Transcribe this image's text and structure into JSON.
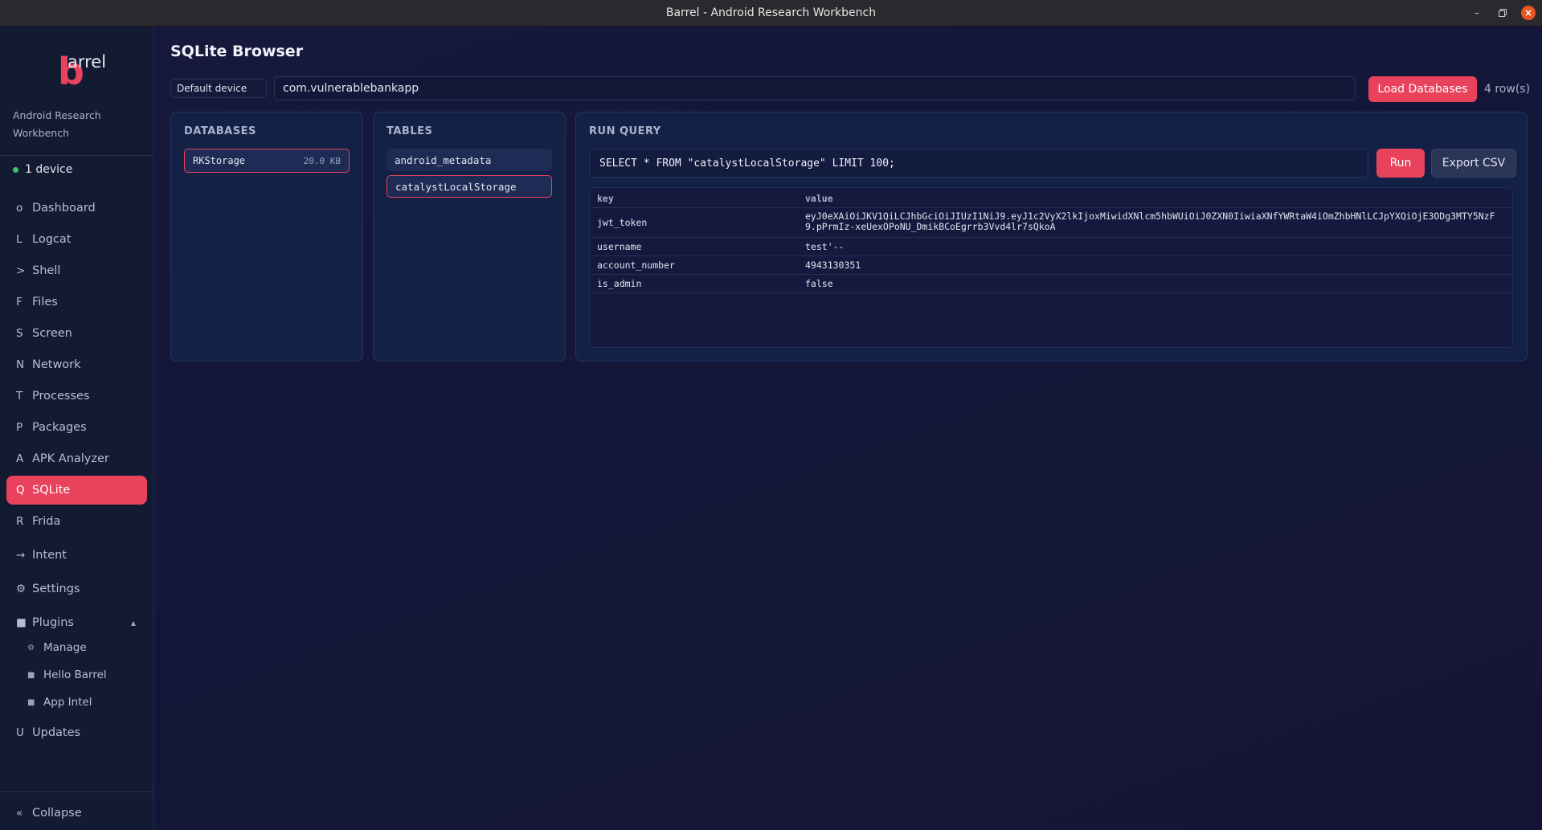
{
  "window": {
    "title": "Barrel - Android Research Workbench"
  },
  "sidebar": {
    "logo_text": "arrel",
    "logo_letter": "b",
    "tagline": "Android Research Workbench",
    "device_status": "1 device",
    "nav": [
      {
        "glyph": "o",
        "label": "Dashboard"
      },
      {
        "glyph": "L",
        "label": "Logcat"
      },
      {
        "glyph": ">",
        "label": "Shell"
      },
      {
        "glyph": "F",
        "label": "Files"
      },
      {
        "glyph": "S",
        "label": "Screen"
      },
      {
        "glyph": "N",
        "label": "Network"
      },
      {
        "glyph": "T",
        "label": "Processes"
      },
      {
        "glyph": "P",
        "label": "Packages"
      },
      {
        "glyph": "A",
        "label": "APK Analyzer"
      },
      {
        "glyph": "Q",
        "label": "SQLite"
      },
      {
        "glyph": "R",
        "label": "Frida"
      },
      {
        "glyph": "→",
        "label": "Intent"
      },
      {
        "glyph": "⚙",
        "label": "Settings"
      },
      {
        "glyph": "■",
        "label": "Plugins"
      }
    ],
    "plugins_caret": "▲",
    "plugin_items": [
      {
        "glyph": "⚙",
        "label": "Manage"
      },
      {
        "glyph": "■",
        "label": "Hello Barrel"
      },
      {
        "glyph": "■",
        "label": "App Intel"
      }
    ],
    "updates": {
      "glyph": "U",
      "label": "Updates"
    },
    "collapse": {
      "glyph": "«",
      "label": "Collapse"
    }
  },
  "main": {
    "title": "SQLite Browser",
    "device_select": "Default device",
    "package_value": "com.vulnerablebankapp",
    "load_button": "Load Databases",
    "row_count": "4 row(s)",
    "databases": {
      "label": "DATABASES",
      "items": [
        {
          "name": "RKStorage",
          "size": "20.0 KB"
        }
      ]
    },
    "tables": {
      "label": "TABLES",
      "items": [
        "android_metadata",
        "catalystLocalStorage"
      ]
    },
    "query": {
      "label": "RUN QUERY",
      "sql": "SELECT * FROM \"catalystLocalStorage\" LIMIT 100;",
      "run_button": "Run",
      "export_button": "Export CSV",
      "columns": [
        "key",
        "value"
      ],
      "rows": [
        {
          "key": "jwt_token",
          "value": "eyJ0eXAiOiJKV1QiLCJhbGciOiJIUzI1NiJ9.eyJ1c2VyX2lkIjoxMiwidXNlcm5hbWUiOiJ0ZXN0IiwiaXNfYWRtaW4iOmZhbHNlLCJpYXQiOjE3ODg3MTY5NzF9.pPrmIz-xeUexOPoNU_DmikBCoEgrrb3Vvd4lr7sQkoA"
        },
        {
          "key": "username",
          "value": "test'--"
        },
        {
          "key": "account_number",
          "value": "4943130351"
        },
        {
          "key": "is_admin",
          "value": "false"
        }
      ]
    }
  }
}
